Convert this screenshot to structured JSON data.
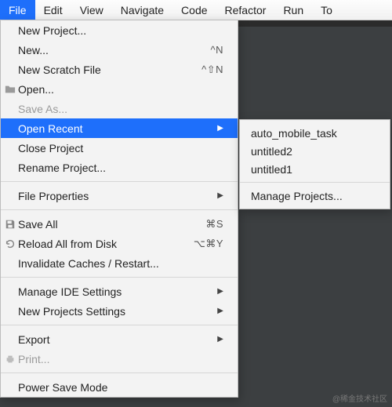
{
  "menubar": {
    "items": [
      "File",
      "Edit",
      "View",
      "Navigate",
      "Code",
      "Refactor",
      "Run",
      "To"
    ],
    "active_index": 0
  },
  "dropdown": {
    "new_project": "New Project...",
    "new": "New...",
    "new_shortcut": "^N",
    "new_scratch": "New Scratch File",
    "new_scratch_shortcut": "^⇧N",
    "open": "Open...",
    "save_as": "Save As...",
    "open_recent": "Open Recent",
    "close_project": "Close Project",
    "rename_project": "Rename Project...",
    "file_properties": "File Properties",
    "save_all": "Save All",
    "save_all_shortcut": "⌘S",
    "reload_all": "Reload All from Disk",
    "reload_all_shortcut": "⌥⌘Y",
    "invalidate": "Invalidate Caches / Restart...",
    "manage_ide": "Manage IDE Settings",
    "new_projects_settings": "New Projects Settings",
    "export": "Export",
    "print": "Print...",
    "power_save": "Power Save Mode"
  },
  "submenu": {
    "items": [
      "auto_mobile_task",
      "untitled2",
      "untitled1"
    ],
    "manage": "Manage Projects..."
  },
  "watermark": "@稀金技术社区"
}
